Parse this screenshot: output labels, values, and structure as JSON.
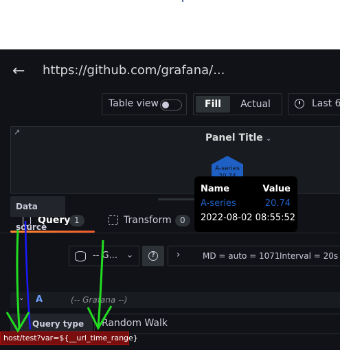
{
  "header": {
    "back_icon": "arrow-left-icon",
    "title": "https://github.com/grafana/..."
  },
  "toolbar": {
    "table_view_label": "Table view",
    "table_view_on": false,
    "fill_label": "Fill",
    "actual_label": "Actual",
    "time_range_label": "Last 6",
    "time_icon": "clock-icon"
  },
  "panel": {
    "title": "Panel Title",
    "title_icon": "chevron-down-icon",
    "link_icon": "external-link-icon",
    "hex_label": "A-series",
    "hex_value": "20.74",
    "hex_color": "#1f60c4"
  },
  "tooltip": {
    "name_header": "Name",
    "value_header": "Value",
    "series": "A-series",
    "value": "20.74",
    "time": "2022-08-02 08:55:52",
    "series_color": "#1f60c4"
  },
  "tabs": [
    {
      "label": "Query",
      "count": "1",
      "active": true,
      "icon": "database-icon"
    },
    {
      "label": "Transform",
      "count": "0",
      "active": false,
      "icon": "transform-icon"
    }
  ],
  "datasource": {
    "label": "Data source",
    "value": "-- G...",
    "help_icon": "question-circle-icon",
    "expand_icon": "chevron-right-icon",
    "md": "MD = auto = 1071",
    "interval": "Interval = 20s"
  },
  "query": {
    "letter": "A",
    "datasource_hint": "(-- Grafana --)",
    "type_label": "Query type",
    "type_value": "Random Walk"
  },
  "status_url": "host/test?var=${__url_time_range}",
  "colors": {
    "accent": "#ff8833",
    "bg": "#111217",
    "panel_bg": "#181b1f"
  }
}
